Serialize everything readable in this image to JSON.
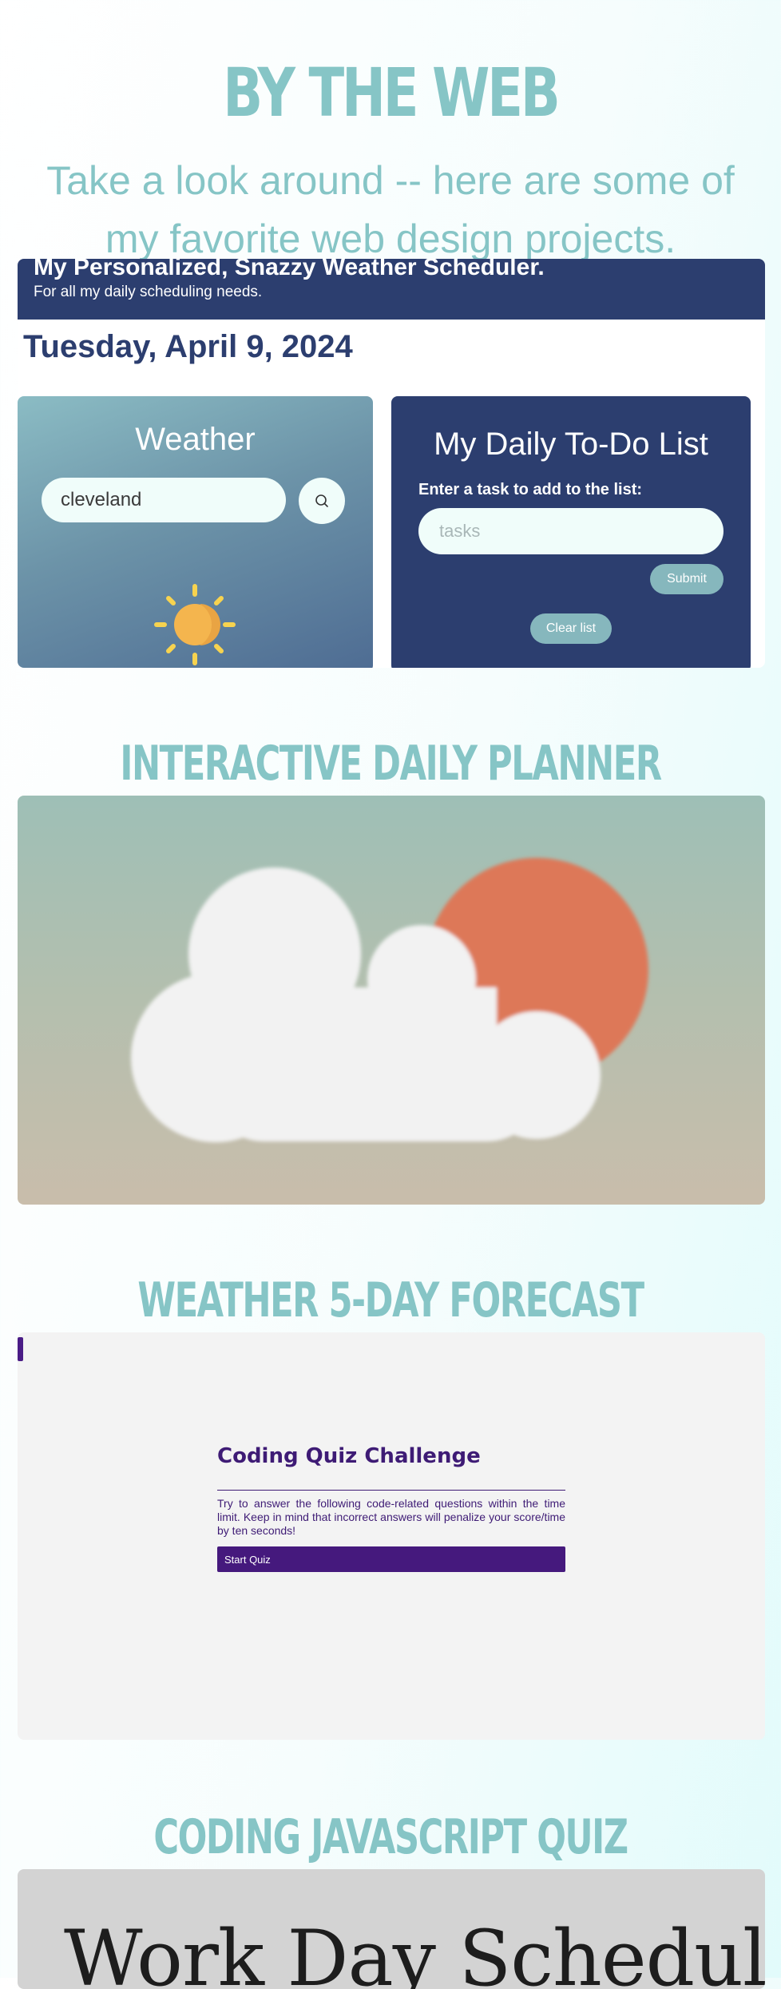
{
  "page": {
    "title": "BY THE WEB",
    "intro": "Take a look around -- here are some of my favorite web design projects."
  },
  "projects": [
    {
      "section_title": "INTERACTIVE DAILY PLANNER",
      "preview": {
        "header_title": "My Personalized, Snazzy Weather Scheduler.",
        "header_subtitle": "For all my daily scheduling needs.",
        "date": "Tuesday, April 9, 2024",
        "weather": {
          "heading": "Weather",
          "city_value": "cleveland",
          "search_icon": "search-icon",
          "condition_icon": "sun-icon"
        },
        "todo": {
          "heading": "My Daily To-Do List",
          "label": "Enter a task to add to the list:",
          "input_placeholder": "tasks",
          "submit_label": "Submit",
          "clear_label": "Clear list"
        }
      }
    },
    {
      "section_title": "WEATHER 5-DAY FORECAST",
      "preview": {
        "image_icon": "sun-behind-cloud-icon"
      }
    },
    {
      "section_title": "CODING JAVASCRIPT QUIZ",
      "preview": {
        "title": "Coding Quiz Challenge",
        "description": "Try to answer the following code-related questions within the time limit. Keep in mind that incorrect answers will penalize your score/time by ten seconds!",
        "start_label": "Start Quiz"
      }
    },
    {
      "preview": {
        "title": "Work Day Scheduler"
      }
    }
  ],
  "colors": {
    "accent_teal": "#86c5c6",
    "navy": "#2c3e6f",
    "quiz_purple": "#45197d",
    "sun_orange": "#dd7858",
    "sun_yellow": "#f4b54e"
  }
}
